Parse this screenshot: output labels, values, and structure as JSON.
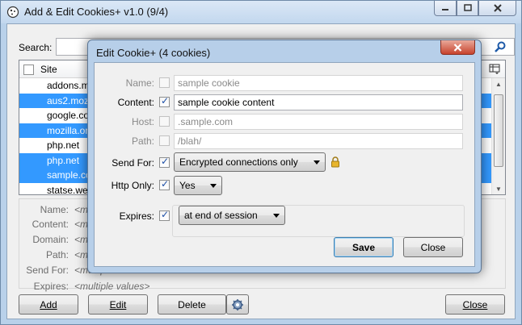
{
  "main_window": {
    "title": "Add & Edit Cookies+ v1.0 (9/4)"
  },
  "search": {
    "label": "Search:",
    "value": ""
  },
  "list": {
    "column_site": "Site",
    "rows": [
      {
        "site": "addons.m",
        "selected": false
      },
      {
        "site": "aus2.mozi",
        "selected": true
      },
      {
        "site": "google.co",
        "selected": false
      },
      {
        "site": "mozilla.or",
        "selected": true
      },
      {
        "site": "php.net",
        "selected": false
      },
      {
        "site": "php.net",
        "selected": true
      },
      {
        "site": "sample.co",
        "selected": true
      },
      {
        "site": "statse.web",
        "selected": false
      }
    ]
  },
  "details": [
    {
      "label": "Name:",
      "value": "<multiple"
    },
    {
      "label": "Content:",
      "value": "<multiple"
    },
    {
      "label": "Domain:",
      "value": "<multiple"
    },
    {
      "label": "Path:",
      "value": "<multiple"
    },
    {
      "label": "Send For:",
      "value": "<multiple"
    },
    {
      "label": "Expires:",
      "value": "<multiple values>"
    }
  ],
  "buttons": {
    "add": "Add",
    "edit": "Edit",
    "delete": "Delete",
    "close": "Close"
  },
  "dialog": {
    "title": "Edit Cookie+ (4 cookies)",
    "fields": {
      "name": {
        "label": "Name:",
        "checked": false,
        "value": "sample cookie"
      },
      "content": {
        "label": "Content:",
        "checked": true,
        "value": "sample cookie content"
      },
      "host": {
        "label": "Host:",
        "checked": false,
        "value": ".sample.com"
      },
      "path": {
        "label": "Path:",
        "checked": false,
        "value": "/blah/"
      },
      "send_for": {
        "label": "Send For:",
        "checked": true,
        "value": "Encrypted connections only"
      },
      "http_only": {
        "label": "Http Only:",
        "checked": true,
        "value": "Yes"
      },
      "expires": {
        "label": "Expires:",
        "checked": true,
        "value": "at end of session"
      }
    },
    "save_label": "Save",
    "close_label": "Close"
  },
  "colors": {
    "selection": "#3399ff",
    "window_frame": "#b9d1ea",
    "close_button": "#c7432d"
  }
}
